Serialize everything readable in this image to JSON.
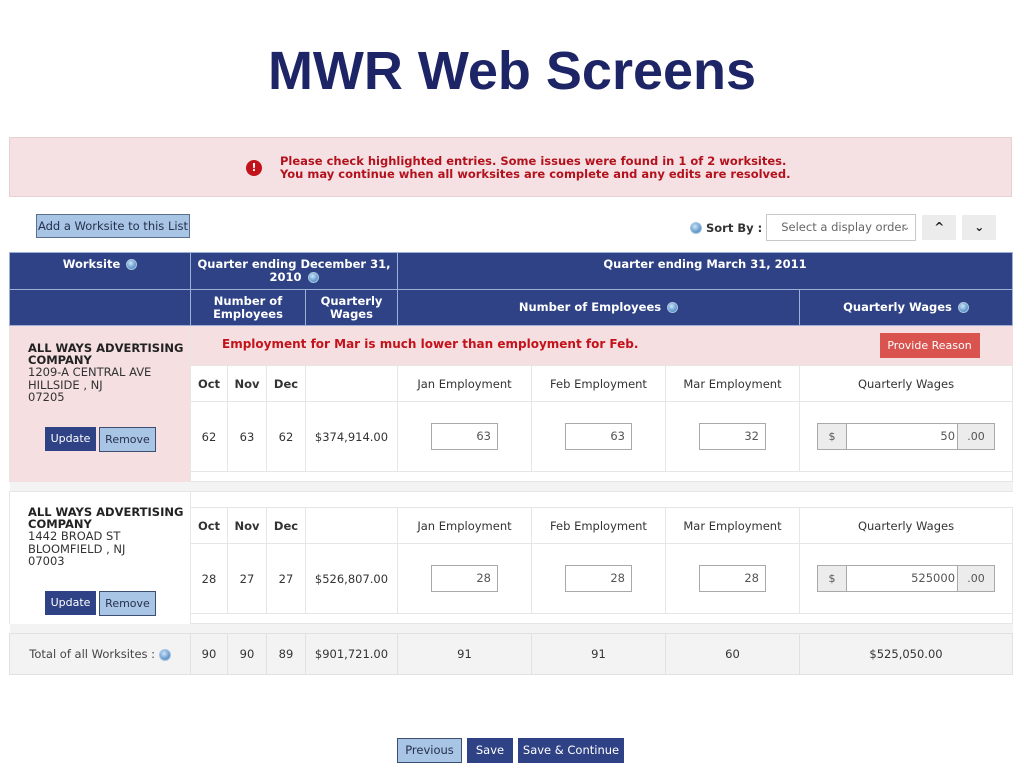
{
  "slide_title": "MWR Web Screens",
  "alert": {
    "icon": "exclamation-icon",
    "line1": "Please check highlighted entries. Some issues were found in 1 of 2 worksites.",
    "line2": "You may continue when all worksites are complete and any edits are resolved."
  },
  "toolbar": {
    "add_worksite_label": "Add a Worksite to this List",
    "sort_label": "Sort By :",
    "sort_placeholder": "Select a display order",
    "sort_up": "▲",
    "sort_down": "▼"
  },
  "header": {
    "worksite": "Worksite",
    "q4_title": "Quarter ending December 31, 2010",
    "q1_title": "Quarter ending March 31, 2011",
    "q4_employees": "Number of Employees",
    "q4_wages": "Quarterly Wages",
    "q1_employees": "Number of Employees",
    "q1_wages": "Quarterly Wages"
  },
  "sub_header": {
    "oct": "Oct",
    "nov": "Nov",
    "dec": "Dec",
    "jan": "Jan Employment",
    "feb": "Feb Employment",
    "mar": "Mar Employment",
    "wages": "Quarterly Wages"
  },
  "worksites": [
    {
      "name": "ALL WAYS ADVERTISING COMPANY",
      "address1": "1209-A CENTRAL AVE",
      "address2": "HILLSIDE ,  NJ",
      "zip": "07205",
      "update_label": "Update",
      "remove_label": "Remove",
      "error": "Employment for Mar is much lower than employment for Feb.",
      "reason_label": "Provide Reason",
      "oct": "62",
      "nov": "63",
      "dec": "62",
      "q4_wages": "$374,914.00",
      "jan": "63",
      "feb": "63",
      "mar": "32",
      "wage_prefix": "$",
      "wage_value": "50",
      "wage_suffix": ".00"
    },
    {
      "name": "ALL WAYS ADVERTISING COMPANY",
      "address1": "1442 BROAD ST",
      "address2": "BLOOMFIELD ,  NJ",
      "zip": "07003",
      "update_label": "Update",
      "remove_label": "Remove",
      "oct": "28",
      "nov": "27",
      "dec": "27",
      "q4_wages": "$526,807.00",
      "jan": "28",
      "feb": "28",
      "mar": "28",
      "wage_prefix": "$",
      "wage_value": "525000",
      "wage_suffix": ".00"
    }
  ],
  "totals": {
    "label": "Total of all Worksites :",
    "oct": "90",
    "nov": "90",
    "dec": "89",
    "q4_wages": "$901,721.00",
    "jan": "91",
    "feb": "91",
    "mar": "60",
    "q1_wages": "$525,050.00"
  },
  "footer": {
    "previous_label": "Previous",
    "save_label": "Save",
    "save_continue_label": "Save & Continue"
  },
  "colors": {
    "header_bg": "#2e4285",
    "error_text": "#c4121b",
    "error_bg": "#f5dfe1",
    "reason_button": "#d9534f",
    "title": "#1e2566"
  }
}
